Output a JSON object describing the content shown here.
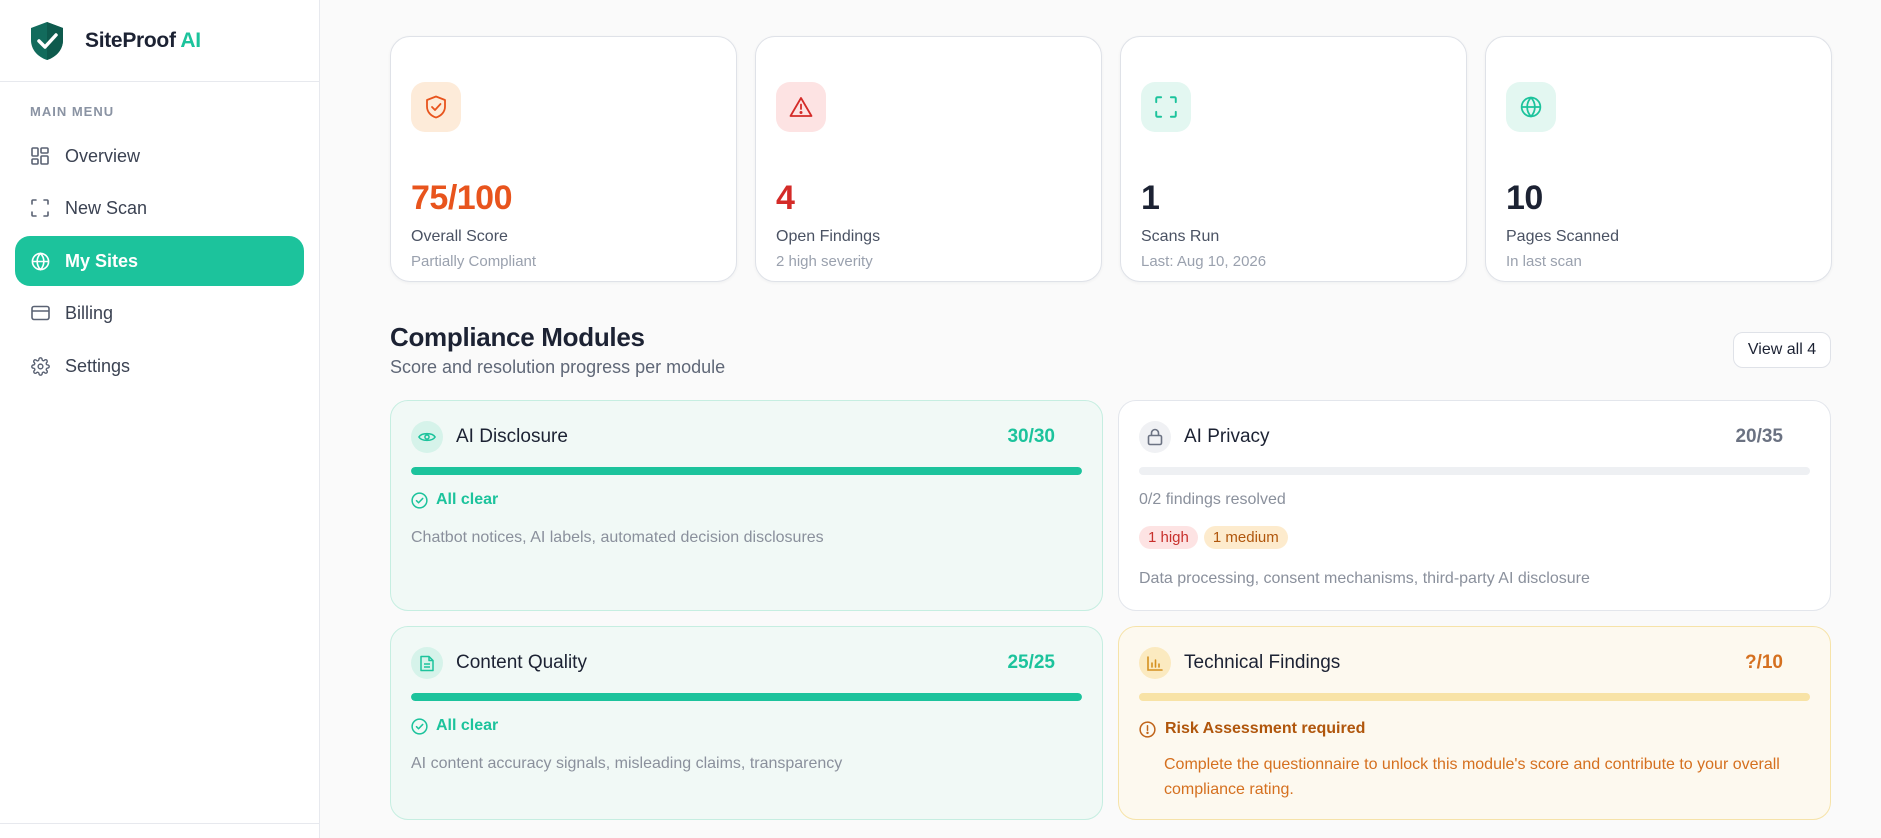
{
  "brand": {
    "name": "SiteProof",
    "accent": "AI"
  },
  "sidebar": {
    "heading": "MAIN MENU",
    "items": [
      {
        "label": "Overview",
        "icon": "layout-grid-icon"
      },
      {
        "label": "New Scan",
        "icon": "scan-frame-icon"
      },
      {
        "label": "My Sites",
        "icon": "globe-icon",
        "active": true
      },
      {
        "label": "Billing",
        "icon": "credit-card-icon"
      },
      {
        "label": "Settings",
        "icon": "gear-icon"
      }
    ]
  },
  "stats": [
    {
      "value": "75/100",
      "label": "Overall Score",
      "sub": "Partially Compliant",
      "icon": "shield-check-icon",
      "color": "#e8541d"
    },
    {
      "value": "4",
      "label": "Open Findings",
      "sub": "2 high severity",
      "icon": "warning-triangle-icon",
      "color": "#d42b28"
    },
    {
      "value": "1",
      "label": "Scans Run",
      "sub": "Last: Aug 10, 2026",
      "icon": "scan-frame-icon",
      "color": "#1c2233"
    },
    {
      "value": "10",
      "label": "Pages Scanned",
      "sub": "In last scan",
      "icon": "globe-icon",
      "color": "#1c2233"
    }
  ],
  "modules_section": {
    "title": "Compliance Modules",
    "subtitle": "Score and resolution progress per module",
    "view_all_label": "View all 4"
  },
  "modules": [
    {
      "title": "AI Disclosure",
      "score": "30/30",
      "progress": 1.0,
      "status": "All clear",
      "description": "Chatbot notices, AI labels, automated decision disclosures",
      "icon": "eye-icon"
    },
    {
      "title": "AI Privacy",
      "score": "20/35",
      "progress": 0.0,
      "status": "0/2 findings resolved",
      "badges": [
        "1 high",
        "1 medium"
      ],
      "description": "Data processing, consent mechanisms, third-party AI disclosure",
      "icon": "lock-icon"
    },
    {
      "title": "Content Quality",
      "score": "25/25",
      "progress": 1.0,
      "status": "All clear",
      "description": "AI content accuracy signals, misleading claims, transparency",
      "icon": "document-icon"
    },
    {
      "title": "Technical Findings",
      "score": "?/10",
      "progress": 1.0,
      "status": "Risk Assessment required",
      "description": "Complete the questionnaire to unlock this module's score and contribute to your overall compliance rating.",
      "icon": "bar-chart-icon"
    }
  ],
  "colors": {
    "accent": "#1cc39c",
    "danger": "#d42b28",
    "warning": "#b0560c"
  }
}
